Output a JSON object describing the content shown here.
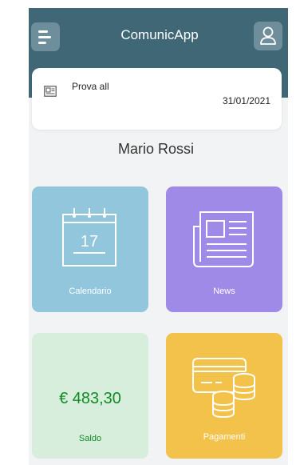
{
  "header": {
    "title": "ComunicApp",
    "menu_icon": "menu-icon",
    "user_icon": "user-icon"
  },
  "notice": {
    "icon": "newspaper-icon",
    "title": "Prova all",
    "date": "31/01/2021"
  },
  "user": {
    "name": "Mario Rossi"
  },
  "tiles": {
    "calendar": {
      "label": "Calendario",
      "day": "17",
      "icon": "calendar-icon",
      "color": "#91c6dc"
    },
    "news": {
      "label": "News",
      "icon": "newspaper-icon",
      "color": "#a08ae8"
    },
    "saldo": {
      "label": "Saldo",
      "amount": "€ 483,30",
      "color": "#d6eedb"
    },
    "payments": {
      "label": "Pagamenti",
      "icon": "payment-card-coins-icon",
      "color": "#f2c24a"
    }
  },
  "colors": {
    "header": "#3f6776",
    "accent_green": "#148a25"
  }
}
